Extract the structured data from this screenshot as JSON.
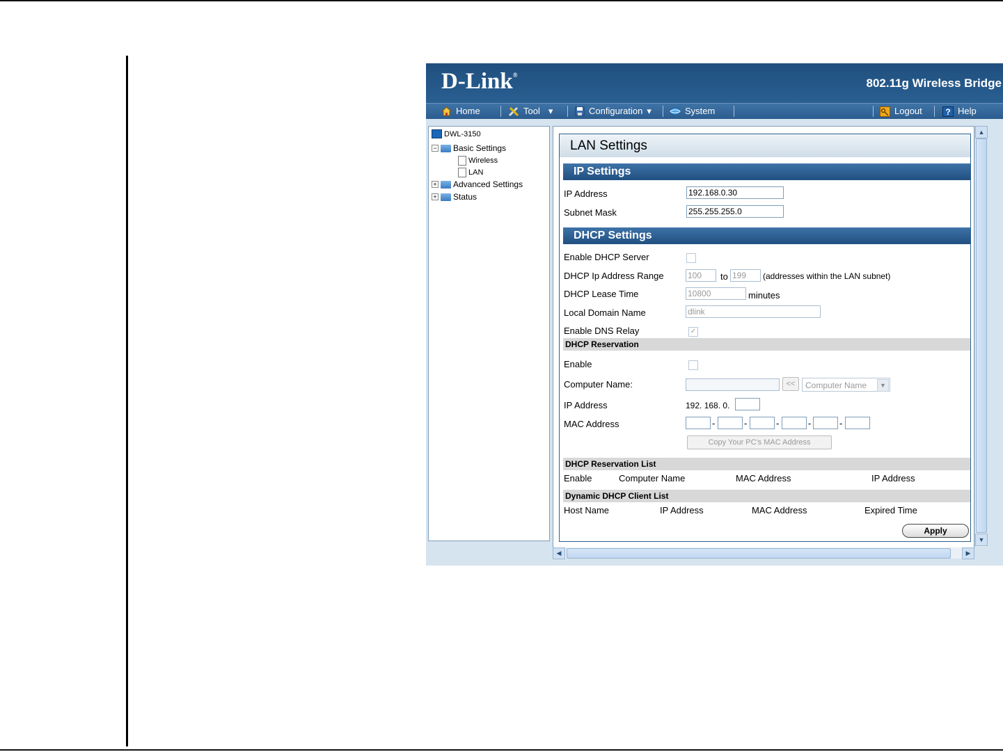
{
  "header": {
    "logo_text": "D-Link",
    "logo_mark": "®",
    "product_title": "802.11g Wireless Bridge"
  },
  "menubar": {
    "home": "Home",
    "tool": "Tool",
    "configuration": "Configuration",
    "system": "System",
    "logout": "Logout",
    "help": "Help",
    "tool_caret": "▾",
    "config_caret": "▾"
  },
  "tree": {
    "root": "DWL-3150",
    "basic_settings": "Basic Settings",
    "wireless": "Wireless",
    "lan": "LAN",
    "advanced_settings": "Advanced Settings",
    "status": "Status",
    "expanded_sign": "−",
    "collapsed_sign": "+"
  },
  "panel": {
    "title": "LAN Settings",
    "ip_settings": {
      "heading": "IP Settings",
      "ip_label": "IP Address",
      "ip_value": "192.168.0.30",
      "mask_label": "Subnet Mask",
      "mask_value": "255.255.255.0"
    },
    "dhcp_settings": {
      "heading": "DHCP Settings",
      "enable_server_label": "Enable DHCP Server",
      "range_label": "DHCP Ip Address Range",
      "range_start": "100",
      "range_to": "to",
      "range_end": "199",
      "range_note": "(addresses within the LAN subnet)",
      "lease_label": "DHCP Lease Time",
      "lease_value": "10800",
      "lease_unit": "minutes",
      "domain_label": "Local Domain Name",
      "domain_value": "dlink",
      "dns_relay_label": "Enable DNS Relay",
      "dns_relay_check": "✓"
    },
    "reservation": {
      "heading": "DHCP Reservation",
      "enable_label": "Enable",
      "computer_name_label": "Computer Name:",
      "copy_arrow": "<<",
      "computer_name_select": "Computer Name",
      "ip_label": "IP Address",
      "ip_prefix": "192. 168. 0.",
      "mac_label": "MAC Address",
      "mac_sep": "-",
      "copy_mac_button": "Copy Your PC's MAC Address"
    },
    "reservation_list": {
      "heading": "DHCP Reservation List",
      "columns": [
        "Enable",
        "Computer Name",
        "MAC Address",
        "IP Address"
      ]
    },
    "client_list": {
      "heading": "Dynamic DHCP Client List",
      "columns": [
        "Host Name",
        "IP Address",
        "MAC Address",
        "Expired Time"
      ]
    },
    "apply_button": "Apply"
  },
  "scroll": {
    "up": "▲",
    "down": "▼",
    "left": "◀",
    "right": "▶",
    "dropdown": "▼"
  },
  "colors": {
    "header_blue": "#2a5f92",
    "section_blue": "#214f80"
  }
}
